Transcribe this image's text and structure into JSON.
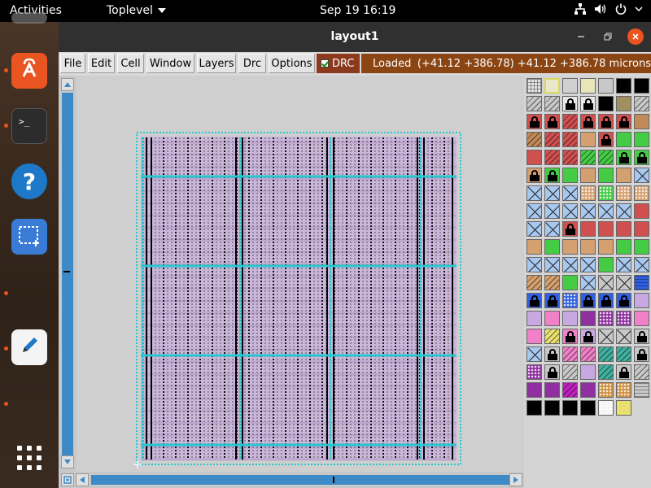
{
  "topbar": {
    "activities": "Activities",
    "app_menu": "Toplevel",
    "clock": "Sep 19  16:19"
  },
  "dock": {
    "apps": [
      {
        "name": "app-center",
        "color": "#e95420"
      },
      {
        "name": "terminal",
        "color": "#2c2c2c"
      },
      {
        "name": "help",
        "color": "#1e78c8"
      },
      {
        "name": "screenshot",
        "color": "#3a7bd5"
      },
      {
        "name": "text-editor",
        "color": "#f4f4f4"
      },
      {
        "name": "show-apps",
        "color": "transparent"
      }
    ]
  },
  "window": {
    "title": "layout1",
    "menu": [
      "File",
      "Edit",
      "Cell",
      "Window",
      "Layers",
      "Drc",
      "Options"
    ],
    "drc_label": "DRC",
    "status": "Loaded",
    "coords": "(+41.12 +386.78) +41.12 +386.78 microns"
  },
  "layout": {
    "background": "#cfcfcf",
    "fill_color": "#c9b6d8",
    "stripe_color": "#000000",
    "bus_color": "#25c8d0"
  },
  "palette": {
    "rows": [
      [
        "grid",
        "pale-yellow-outline",
        "grey-solid",
        "pale-yellow",
        "grey",
        "hatch-black",
        "hatch-black"
      ],
      [
        "grey-hatch",
        "grey-hatch",
        "lock",
        "lock",
        "hatch-black",
        "olive",
        "grey-hatch"
      ],
      [
        "lock-red",
        "lock-red",
        "red-hatch",
        "lock-red",
        "lock-red",
        "lock-red",
        "brown"
      ],
      [
        "brown-hatch",
        "red-hatch",
        "red-hatch",
        "tan",
        "lock-red",
        "green",
        "green"
      ],
      [
        "red",
        "red-hatch",
        "red-hatch",
        "green-hatch",
        "green-hatch",
        "lock-green",
        "lock-green"
      ],
      [
        "lock-tan",
        "lock-green",
        "green",
        "tan",
        "green",
        "tan",
        "blue-cross"
      ],
      [
        "blue-cross",
        "blue-cross",
        "blue-cross",
        "tan-dots",
        "green-dots",
        "tan-dots",
        "tan-dots"
      ],
      [
        "blue-cross",
        "blue-cross",
        "blue-cross",
        "blue-cross",
        "blue-cross",
        "blue-cross",
        "red"
      ],
      [
        "blue-cross",
        "blue-cross",
        "lock-red",
        "red",
        "red",
        "red",
        "red"
      ],
      [
        "tan",
        "green",
        "tan",
        "tan",
        "tan",
        "green",
        "green"
      ],
      [
        "blue-cross",
        "blue-cross",
        "blue-cross",
        "blue-cross",
        "green",
        "blue-cross",
        "blue-cross"
      ],
      [
        "tan-hatch",
        "tan-hatch",
        "green",
        "blue-cross",
        "grey-cross",
        "grey-cross",
        "blue-wave"
      ],
      [
        "lock-blue",
        "lock-blue",
        "blue-dots",
        "lock-blue",
        "lock-blue",
        "lock-blue",
        "lilac"
      ],
      [
        "lilac",
        "pink",
        "lilac",
        "purple",
        "purple-dots",
        "purple-dots",
        "pink"
      ],
      [
        "pink",
        "yellow-hatch",
        "lock-pink",
        "lock-lilac",
        "grey-cross",
        "grey-cross",
        "lock-grey"
      ],
      [
        "green-cross",
        "lock-grey",
        "pink-hatch",
        "pink-hatch",
        "teal-hatch",
        "teal-hatch",
        "lock-grey"
      ],
      [
        "purple-dots",
        "lock-grey",
        "grey-hatch",
        "lilac",
        "teal-hatch",
        "lock-grey",
        "grey-hatch"
      ],
      [
        "purple",
        "purple",
        "magenta-hatch",
        "purple",
        "orange-dots",
        "orange-dots",
        "grey-wave"
      ],
      [
        "lock-black",
        "black",
        "black-hatch",
        "black-hatch",
        "white-dots",
        "yellow"
      ]
    ]
  }
}
